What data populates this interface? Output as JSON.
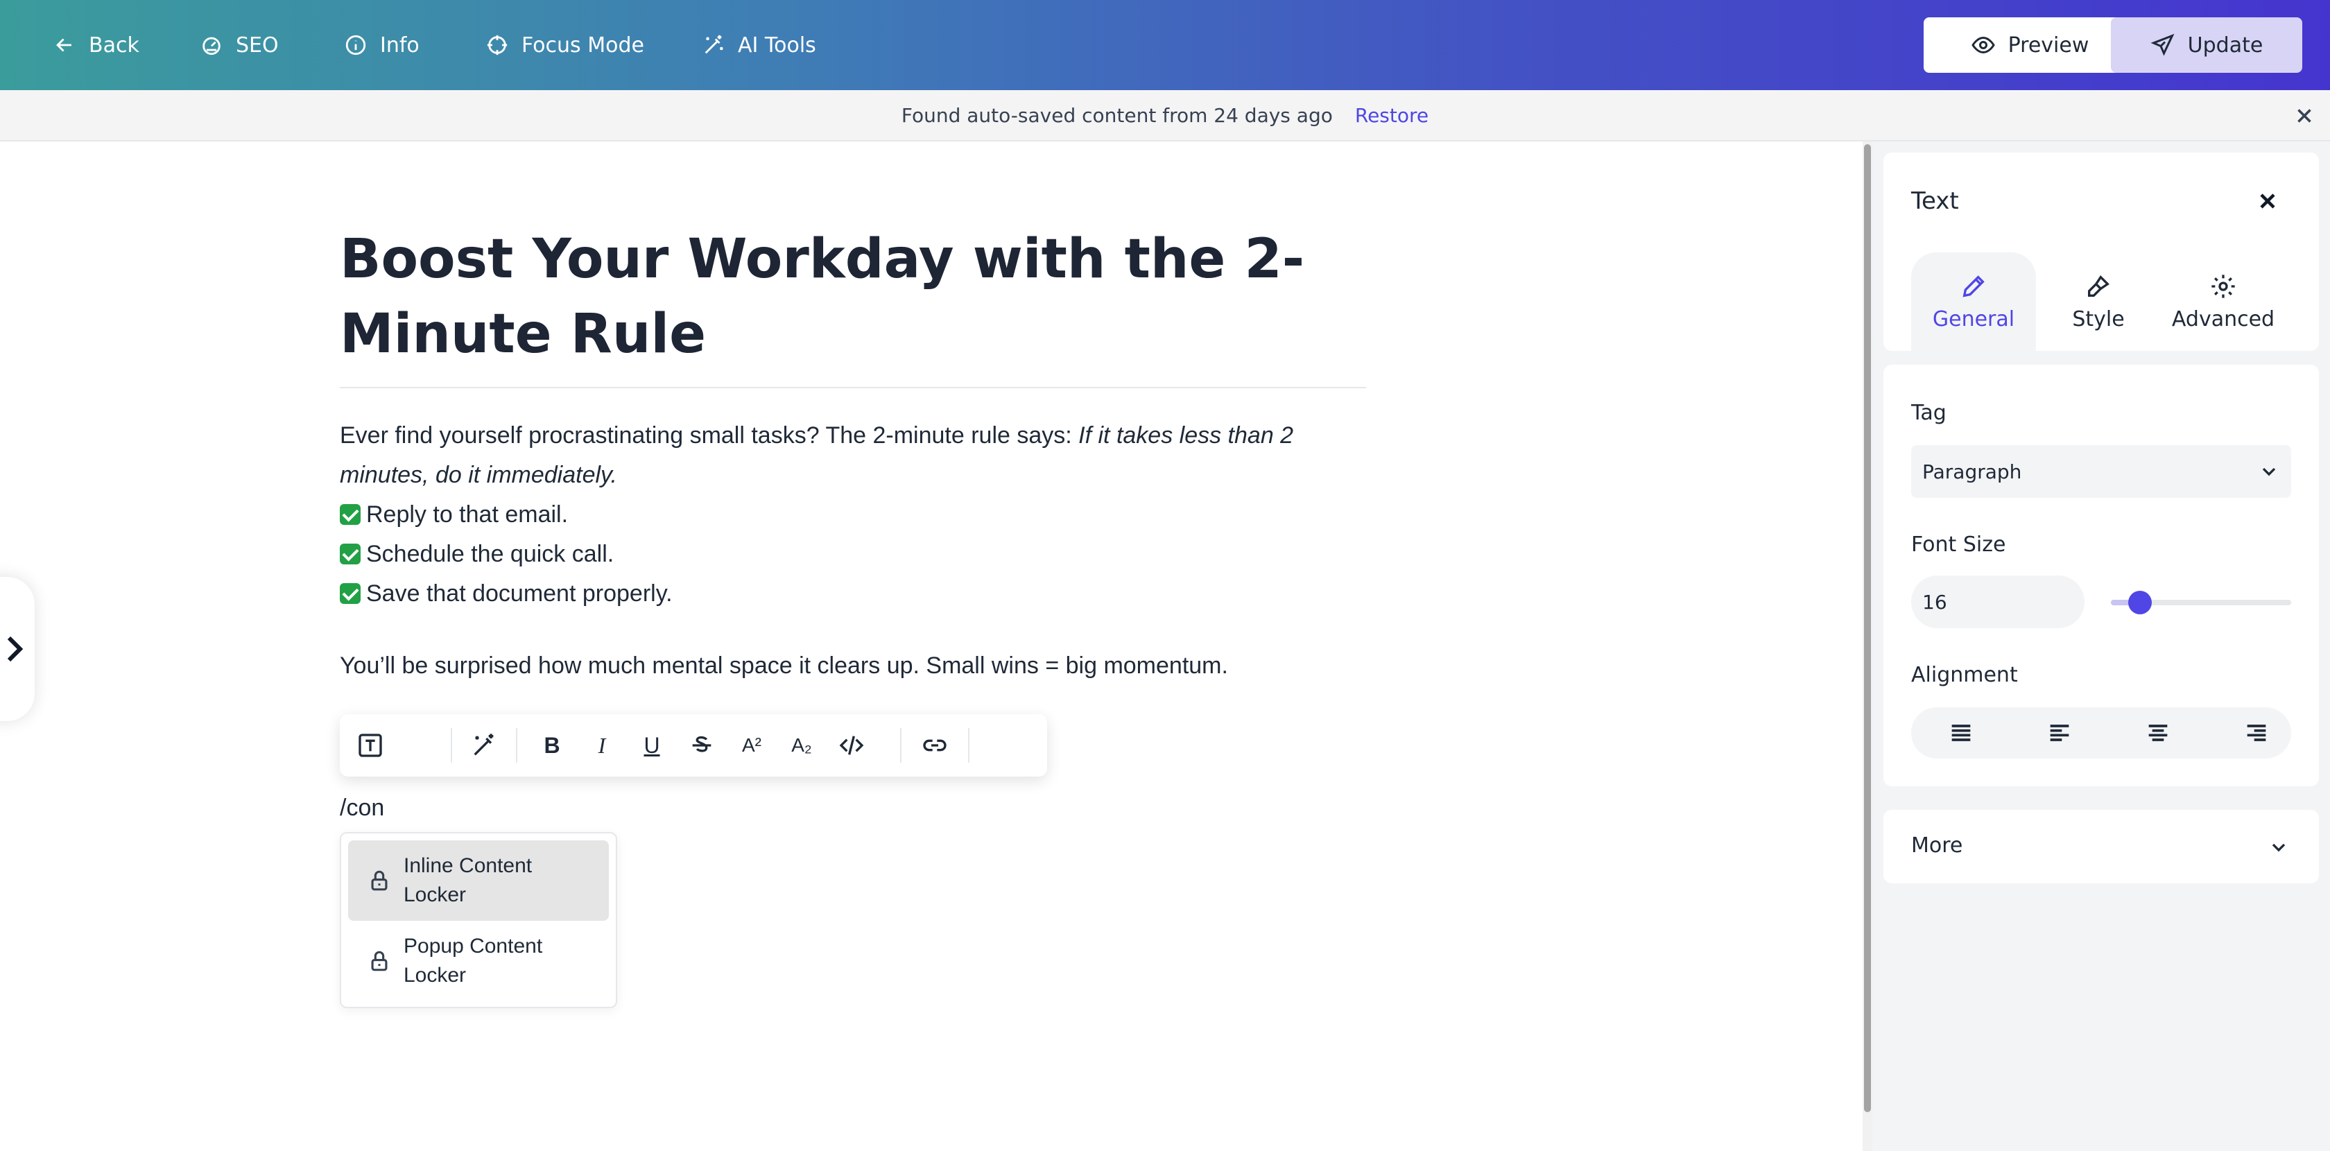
{
  "topbar": {
    "back": "Back",
    "seo": "SEO",
    "info": "Info",
    "focus_mode": "Focus Mode",
    "ai_tools": "AI Tools",
    "preview": "Preview",
    "update": "Update"
  },
  "notice": {
    "message": "Found auto-saved content from 24 days ago",
    "restore": "Restore"
  },
  "editor": {
    "title": "Boost Your Workday with the 2-Minute Rule",
    "intro": "Ever find yourself procrastinating small tasks? The 2-minute rule says: ",
    "intro_italic": "If it takes less than 2 minutes, do it immediately.",
    "checklist": [
      "Reply to that email.",
      "Schedule the quick call.",
      "Save that document properly."
    ],
    "closing": "You’ll be surprised how much mental space it clears up. Small wins = big momentum.",
    "slash_command": "/con",
    "menu_items": [
      "Inline Content Locker",
      "Popup Content Locker"
    ],
    "toolbar": {
      "bold": "B",
      "italic": "I",
      "underline": "U",
      "superscript": "A²",
      "subscript": "A₂"
    }
  },
  "panel": {
    "title": "Text",
    "tabs": [
      "General",
      "Style",
      "Advanced"
    ],
    "active_tab": "General",
    "tag_label": "Tag",
    "tag_value": "Paragraph",
    "font_size_label": "Font Size",
    "font_size_value": "16",
    "font_size_slider_fraction": 0.16,
    "alignment_label": "Alignment",
    "more_label": "More"
  },
  "colors": {
    "accent": "#4f46e5",
    "gradient_start": "#3b9c9c",
    "gradient_end": "#4535cf",
    "check": "#22a045"
  }
}
